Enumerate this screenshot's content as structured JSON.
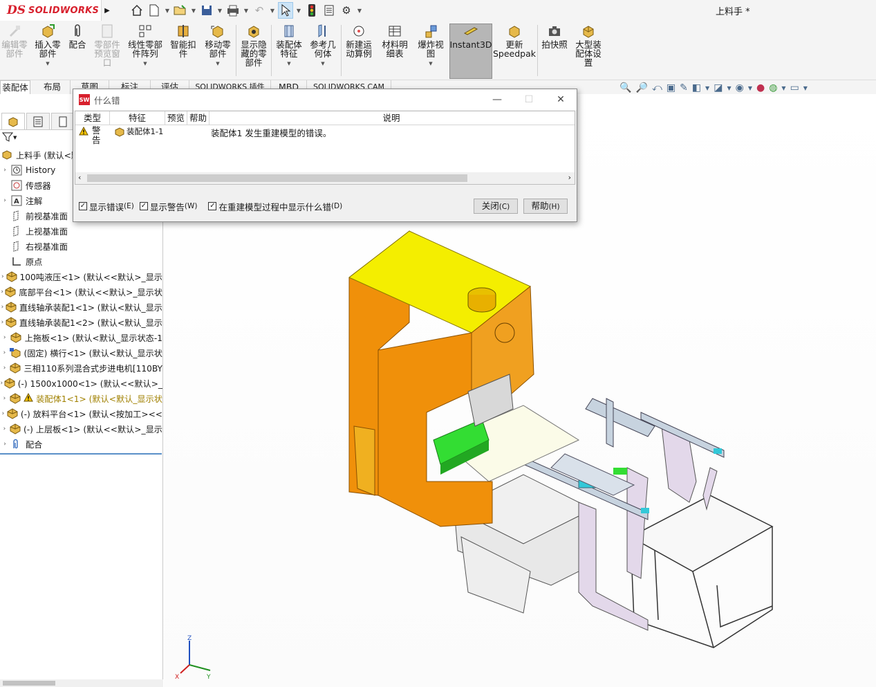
{
  "app": {
    "logo_ds": "DS",
    "logo_text": "SOLIDWORKS",
    "document_title": "上料手 *"
  },
  "ribbon": {
    "buttons": [
      {
        "label": "编辑零\n部件",
        "enabled": false
      },
      {
        "label": "插入零\n部件",
        "enabled": true
      },
      {
        "label": "配合",
        "enabled": true
      },
      {
        "label": "零部件\n预览窗\n口",
        "enabled": false
      },
      {
        "label": "线性零部\n件阵列",
        "enabled": true
      },
      {
        "label": "智能扣\n件",
        "enabled": true
      },
      {
        "label": "移动零\n部件",
        "enabled": true
      },
      {
        "label": "显示隐\n藏的零\n部件",
        "enabled": true
      },
      {
        "label": "装配体\n特征",
        "enabled": true
      },
      {
        "label": "参考几\n何体",
        "enabled": true
      },
      {
        "label": "新建运\n动算例",
        "enabled": true
      },
      {
        "label": "材料明\n细表",
        "enabled": true
      },
      {
        "label": "爆炸视\n图",
        "enabled": true
      },
      {
        "label": "Instant3D",
        "enabled": true
      },
      {
        "label": "更新\nSpeedpak",
        "enabled": true
      },
      {
        "label": "拍快照",
        "enabled": true
      },
      {
        "label": "大型装\n配体设\n置",
        "enabled": true
      }
    ]
  },
  "command_tabs": [
    "装配体",
    "布局",
    "草图",
    "标注",
    "评估",
    "SOLIDWORKS 插件",
    "MBD",
    "SOLIDWORKS CAM"
  ],
  "tree": {
    "root_label": "上料手 (默认<默",
    "items": [
      {
        "label": "History",
        "icon": "history-icon",
        "expandable": true
      },
      {
        "label": "传感器",
        "icon": "sensor-icon",
        "expandable": false
      },
      {
        "label": "注解",
        "icon": "annotation-icon",
        "expandable": true
      },
      {
        "label": "前视基准面",
        "icon": "plane-icon",
        "expandable": false
      },
      {
        "label": "上视基准面",
        "icon": "plane-icon",
        "expandable": false
      },
      {
        "label": "右视基准面",
        "icon": "plane-icon",
        "expandable": false
      },
      {
        "label": "原点",
        "icon": "origin-icon",
        "expandable": false
      },
      {
        "label": "100吨液压<1> (默认<<默认>_显示",
        "icon": "subassembly-icon",
        "expandable": true
      },
      {
        "label": "底部平台<1> (默认<<默认>_显示状",
        "icon": "subassembly-icon",
        "expandable": true
      },
      {
        "label": "直线轴承装配1<1> (默认<默认_显示",
        "icon": "subassembly-icon",
        "expandable": true
      },
      {
        "label": "直线轴承装配1<2> (默认<默认_显示",
        "icon": "subassembly-icon",
        "expandable": true
      },
      {
        "label": "上拖板<1> (默认<默认_显示状态-1",
        "icon": "subassembly-icon",
        "expandable": true
      },
      {
        "label": "(固定) 横行<1> (默认<默认_显示状",
        "icon": "fixed-part-icon",
        "expandable": true
      },
      {
        "label": "三相110系列混合式步进电机[110BY",
        "icon": "subassembly-icon",
        "expandable": true
      },
      {
        "label": "(-) 1500x1000<1> (默认<<默认>_",
        "icon": "subassembly-icon",
        "expandable": true
      },
      {
        "label": "装配体1<1> (默认<默认_显示状",
        "icon": "subassembly-icon",
        "expandable": true,
        "warning": true
      },
      {
        "label": "(-) 放料平台<1> (默认<按加工><<",
        "icon": "subassembly-icon",
        "expandable": true
      },
      {
        "label": "(-) 上层板<1> (默认<<默认>_显示",
        "icon": "subassembly-icon",
        "expandable": true
      },
      {
        "label": "配合",
        "icon": "mates-icon",
        "expandable": true
      }
    ]
  },
  "dialog": {
    "title": "什么错",
    "columns": [
      "类型",
      "特征",
      "预览",
      "帮助",
      "说明"
    ],
    "rows": [
      {
        "type": "警告",
        "feature": "装配体1-1",
        "preview": "",
        "help": "",
        "description": "装配体1 发生重建模型的错误。"
      }
    ],
    "checkboxes": [
      {
        "label": "显示错误",
        "accel": "(E)",
        "checked": true
      },
      {
        "label": "显示警告",
        "accel": "(W)",
        "checked": true
      },
      {
        "label": "在重建模型过程中显示什么错",
        "accel": "(D)",
        "checked": true
      }
    ],
    "close_label": "关闭",
    "close_accel": "(C)",
    "help_label": "帮助",
    "help_accel": "(H)"
  },
  "triad": {
    "x": "X",
    "y": "Y",
    "z": "Z"
  },
  "colors": {
    "accent_red": "#d8202d",
    "press_orange": "#f0900a",
    "press_yellow": "#f4ee00",
    "bed_green": "#33dd33",
    "frame_lilac": "#e3d8ea"
  }
}
